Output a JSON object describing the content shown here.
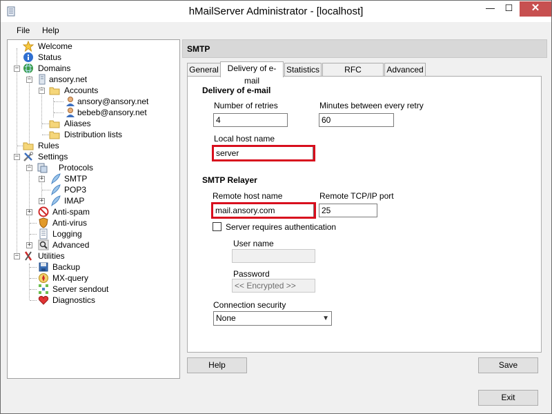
{
  "window": {
    "title": "hMailServer Administrator - [localhost]",
    "close_glyph": "✕",
    "minimize_glyph": "—",
    "maximize_glyph": "☐"
  },
  "menu": [
    "File",
    "Help"
  ],
  "tree": {
    "items": [
      {
        "label": "Welcome",
        "icon": "star-icon"
      },
      {
        "label": "Status",
        "icon": "info-icon"
      },
      {
        "label": "Domains",
        "icon": "globe-icon",
        "expander": "−"
      },
      {
        "label": "ansory.net",
        "icon": "server-icon",
        "expander": "−"
      },
      {
        "label": "Accounts",
        "icon": "folder-icon",
        "expander": "−"
      },
      {
        "label": "ansory@ansory.net",
        "icon": "user-icon"
      },
      {
        "label": "bebeb@ansory.net",
        "icon": "user-icon"
      },
      {
        "label": "Aliases",
        "icon": "folder-icon"
      },
      {
        "label": "Distribution lists",
        "icon": "folder-icon"
      },
      {
        "label": "Rules",
        "icon": "folder-icon"
      },
      {
        "label": "Settings",
        "icon": "tools-icon",
        "expander": "−"
      },
      {
        "label": "Protocols",
        "icon": "protocols-icon",
        "expander": "−"
      },
      {
        "label": "SMTP",
        "icon": "feather-icon",
        "expander": "+"
      },
      {
        "label": "POP3",
        "icon": "feather-icon"
      },
      {
        "label": "IMAP",
        "icon": "feather-icon",
        "expander": "+"
      },
      {
        "label": "Anti-spam",
        "icon": "no-entry-icon",
        "expander": "+"
      },
      {
        "label": "Anti-virus",
        "icon": "shield-icon"
      },
      {
        "label": "Logging",
        "icon": "log-icon"
      },
      {
        "label": "Advanced",
        "icon": "magnifier-icon",
        "expander": "+"
      },
      {
        "label": "Utilities",
        "icon": "wrench-icon",
        "expander": "−"
      },
      {
        "label": "Backup",
        "icon": "disk-icon"
      },
      {
        "label": "MX-query",
        "icon": "compass-icon"
      },
      {
        "label": "Server sendout",
        "icon": "network-icon"
      },
      {
        "label": "Diagnostics",
        "icon": "heart-icon"
      }
    ]
  },
  "panel": {
    "title": "SMTP"
  },
  "tabs": [
    "General",
    "Delivery of e-mail",
    "Statistics",
    "RFC compliance",
    "Advanced"
  ],
  "delivery": {
    "section_title": "Delivery of e-mail",
    "retries_label": "Number of retries",
    "retries_value": "4",
    "minutes_label": "Minutes between every retry",
    "minutes_value": "60",
    "localhost_label": "Local host name",
    "localhost_value": "server"
  },
  "relayer": {
    "section_title": "SMTP Relayer",
    "remote_host_label": "Remote host name",
    "remote_host_value": "mail.ansory.com",
    "port_label": "Remote TCP/IP port",
    "port_value": "25",
    "auth_label": "Server requires authentication",
    "auth_checked": false,
    "username_label": "User name",
    "username_value": "",
    "password_label": "Password",
    "password_value": "<< Encrypted >>",
    "security_label": "Connection security",
    "security_value": "None"
  },
  "buttons": {
    "help": "Help",
    "save": "Save",
    "exit": "Exit"
  },
  "colors": {
    "highlight": "#d80e1d",
    "close_button": "#c75050"
  }
}
